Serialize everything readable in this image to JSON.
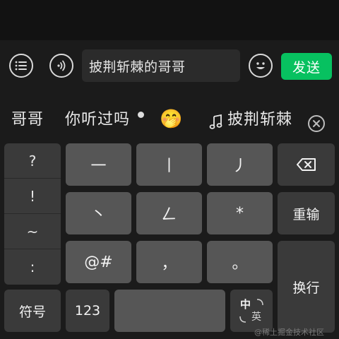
{
  "chat": {
    "input_text": "披荆斩棘的哥哥",
    "send_label": "发送"
  },
  "candidates": {
    "items": [
      "哥哥",
      "你听过吗",
      "披荆斩棘"
    ],
    "emoji": "🤭"
  },
  "keyboard": {
    "symbols": [
      "?",
      "!",
      "~",
      ":"
    ],
    "row1": [
      "一",
      "丨",
      "丿"
    ],
    "row2": [
      "丶",
      "𠃋",
      "*"
    ],
    "row3": [
      "@#",
      "，",
      "。"
    ],
    "backspace_symbol": "⌫",
    "retype_label": "重输",
    "enter_label": "换行",
    "symbols_label": "符号",
    "numbers_label": "123",
    "lang_top": "中",
    "lang_bottom": "英"
  },
  "watermark": "@稀土掘金技术社区",
  "colors": {
    "accent": "#07c160",
    "key": "#565656",
    "key_dark": "#3a3a3a",
    "panel": "#1b1b1b"
  }
}
